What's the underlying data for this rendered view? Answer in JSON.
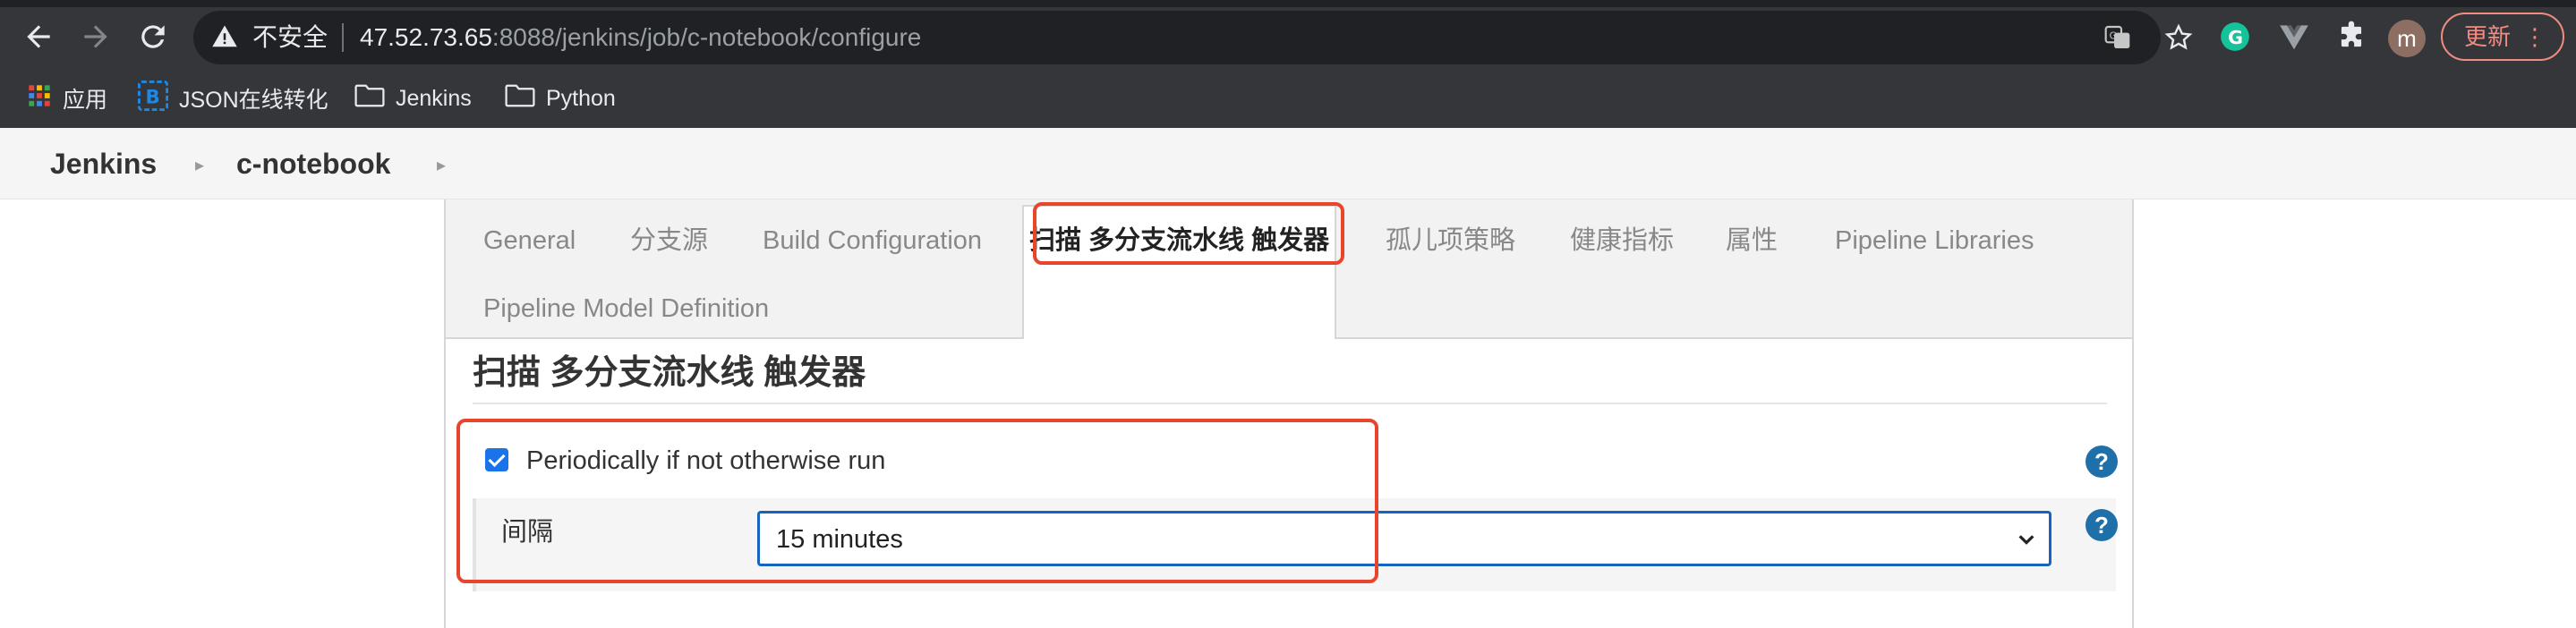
{
  "browser": {
    "insecure_label": "不安全",
    "url_host": "47.52.73.65",
    "url_rest": ":8088/jenkins/job/c-notebook/configure",
    "avatar_letter": "m",
    "update_label": "更新",
    "icons": [
      "back-icon",
      "forward-icon",
      "reload-icon",
      "warning-icon",
      "translate-icon",
      "star-icon",
      "grammarly-icon",
      "vue-devtools-icon",
      "extensions-icon"
    ]
  },
  "bookmarks": [
    {
      "label": "应用",
      "icon": "apps-grid-icon"
    },
    {
      "label": "JSON在线转化",
      "icon": "json-b-icon"
    },
    {
      "label": "Jenkins",
      "icon": "folder-icon"
    },
    {
      "label": "Python",
      "icon": "folder-icon"
    }
  ],
  "breadcrumb": {
    "items": [
      "Jenkins",
      "c-notebook"
    ]
  },
  "tabs": [
    {
      "label": "General"
    },
    {
      "label": "分支源"
    },
    {
      "label": "Build Configuration"
    },
    {
      "label": "扫描 多分支流水线 触发器"
    },
    {
      "label": "孤儿项策略"
    },
    {
      "label": "健康指标"
    },
    {
      "label": "属性"
    },
    {
      "label": "Pipeline Libraries"
    },
    {
      "label": "Pipeline Model Definition"
    }
  ],
  "section": {
    "title": "扫描 多分支流水线 触发器",
    "periodic_checkbox_label": "Periodically if not otherwise run",
    "periodic_checked": true,
    "interval_label": "间隔",
    "interval_value": "15 minutes",
    "help_label": "?"
  },
  "colors": {
    "annotation": "#e8452c",
    "select_border": "#1565c0",
    "help_icon": "#1f6fa8",
    "checkbox": "#1a73e8"
  }
}
